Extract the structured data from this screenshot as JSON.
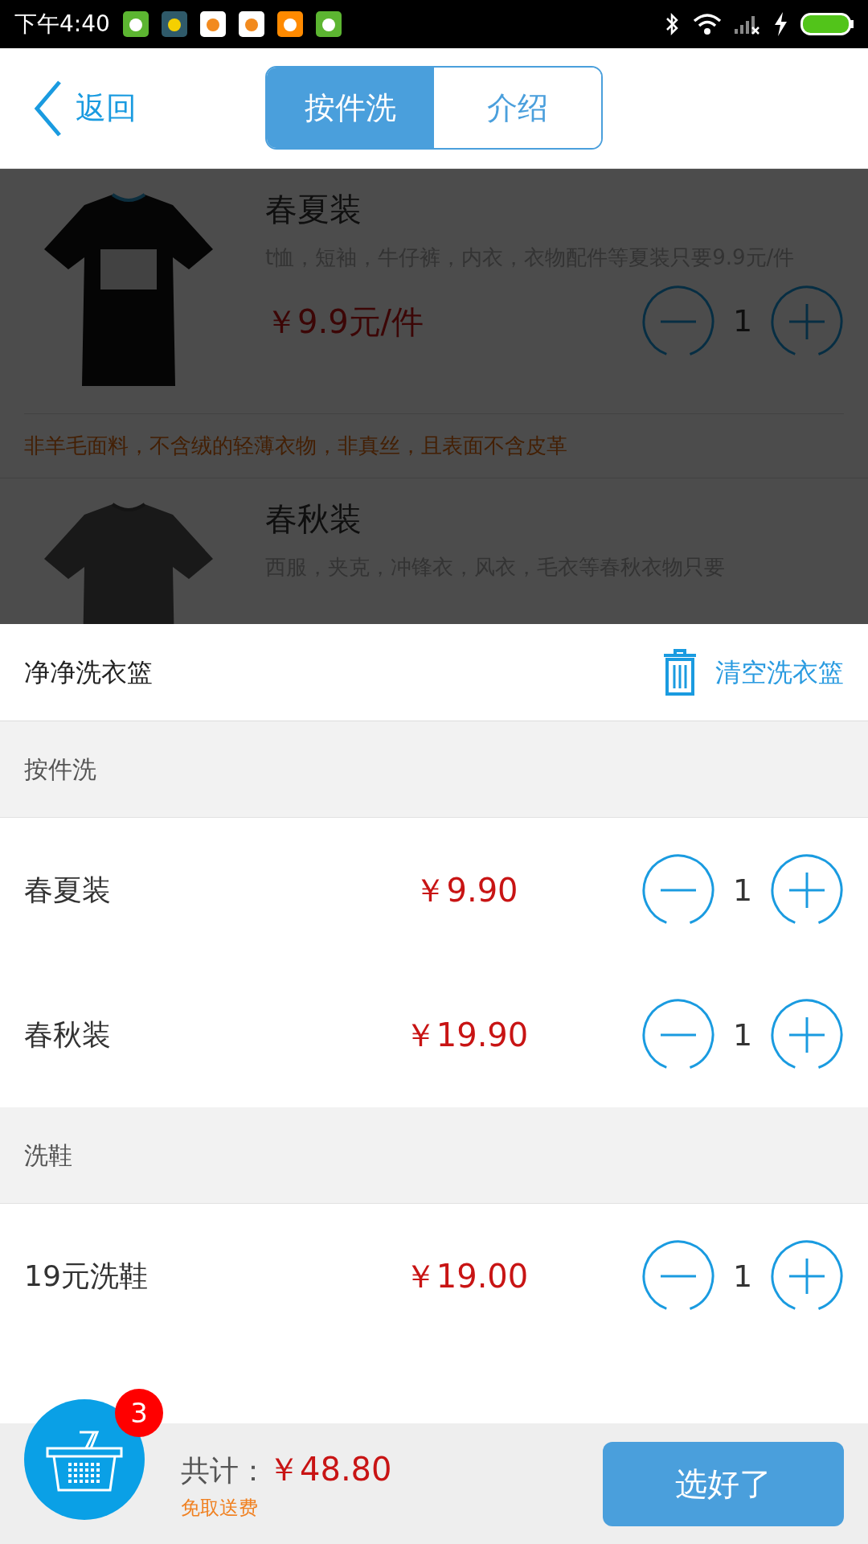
{
  "status_bar": {
    "time": "下午4:40"
  },
  "header": {
    "back_label": "返回",
    "tabs": [
      {
        "label": "按件洗",
        "selected": true
      },
      {
        "label": "介绍",
        "selected": false
      }
    ]
  },
  "products": [
    {
      "title": "春夏装",
      "description": "t恤，短袖，牛仔裤，内衣，衣物配件等夏装只要9.9元/件",
      "price": "￥9.9元/件",
      "quantity": "1",
      "note": "非羊毛面料，不含绒的轻薄衣物，非真丝，且表面不含皮革"
    },
    {
      "title": "春秋装",
      "description": "西服，夹克，冲锋衣，风衣，毛衣等春秋衣物只要"
    }
  ],
  "basket": {
    "title": "净净洗衣篮",
    "clear_label": "清空洗衣篮",
    "sections": [
      {
        "title": "按件洗",
        "items": [
          {
            "name": "春夏装",
            "price": "￥9.90",
            "quantity": "1"
          },
          {
            "name": "春秋装",
            "price": "￥19.90",
            "quantity": "1"
          }
        ]
      },
      {
        "title": "洗鞋",
        "items": [
          {
            "name": "19元洗鞋",
            "price": "￥19.00",
            "quantity": "1"
          }
        ]
      }
    ]
  },
  "footer": {
    "badge": "3",
    "total_label": "共计：",
    "total": "￥48.80",
    "delivery_note": "免取送费",
    "confirm_button": "选好了"
  }
}
